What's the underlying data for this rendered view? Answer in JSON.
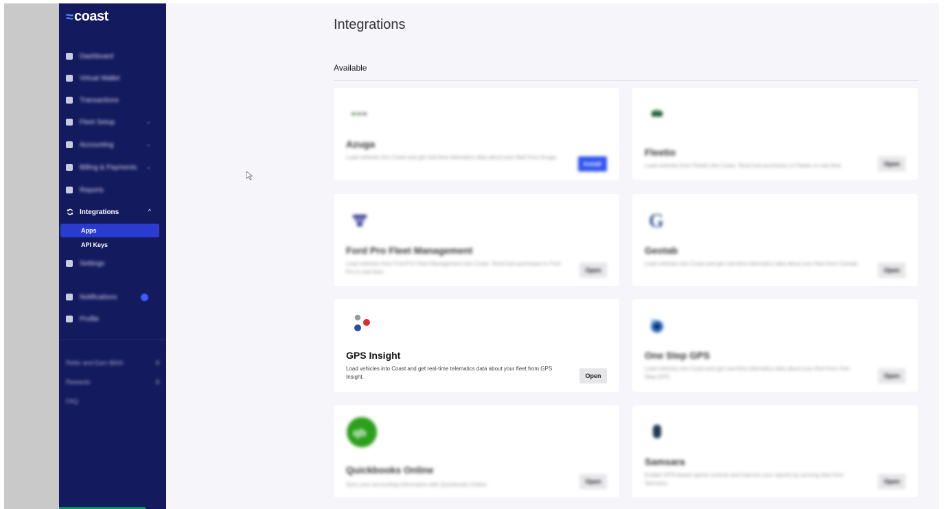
{
  "brand": {
    "logo_text": "coast",
    "logo_mark": "≈"
  },
  "sidebar": {
    "items": [
      {
        "label": "Dashboard",
        "icon": "home-icon"
      },
      {
        "label": "Virtual Wallet",
        "icon": "wallet-icon"
      },
      {
        "label": "Transactions",
        "icon": "list-icon"
      },
      {
        "label": "Fleet Setup",
        "icon": "truck-icon",
        "chevron": "⌄"
      },
      {
        "label": "Accounting",
        "icon": "ledger-icon",
        "chevron": "⌄"
      },
      {
        "label": "Billing & Payments",
        "icon": "card-icon",
        "chevron": "⌄"
      },
      {
        "label": "Reports",
        "icon": "chart-icon"
      },
      {
        "label": "Integrations",
        "icon": "sync-icon",
        "chevron": "^",
        "active": true
      },
      {
        "label": "Settings",
        "icon": "gear-icon"
      },
      {
        "label": "Notifications",
        "icon": "bell-icon"
      },
      {
        "label": "Profile",
        "icon": "user-icon"
      }
    ],
    "sub_items": [
      {
        "label": "Apps",
        "selected": true
      },
      {
        "label": "API Keys",
        "selected": false
      }
    ],
    "bottom_items": [
      {
        "label": "Refer and Earn $500",
        "count": "8"
      },
      {
        "label": "Rewards",
        "count": "8"
      },
      {
        "label": "FAQ",
        "count": ""
      }
    ]
  },
  "main": {
    "title": "Integrations",
    "section_label": "Available",
    "cards": [
      {
        "name": "Azuga",
        "description": "Load vehicles into Coast and get real-time telematics data about your fleet from Azuga.",
        "button": "Install",
        "primary": true,
        "logo": "azuga-logo",
        "blurred": true
      },
      {
        "name": "Fleetio",
        "description": "Load vehicles from Fleetio into Coast. Send fuel purchases to Fleetio in real time.",
        "button": "Open",
        "primary": false,
        "logo": "fleetio-logo",
        "blurred": true
      },
      {
        "name": "Ford Pro Fleet Management",
        "description": "Load vehicles from Ford Pro Fleet Management into Coast. Send fuel purchases to Ford Pro in real time.",
        "button": "Open",
        "primary": false,
        "logo": "ford-pro-logo",
        "blurred": true
      },
      {
        "name": "Geotab",
        "description": "Load vehicles into Coast and get real-time telematics data about your fleet from Geotab.",
        "button": "Open",
        "primary": false,
        "logo": "geotab-logo",
        "blurred": true
      },
      {
        "name": "GPS Insight",
        "description": "Load vehicles into Coast and get real-time telematics data about your fleet from GPS Insight.",
        "button": "Open",
        "primary": false,
        "logo": "gps-insight-logo",
        "blurred": false
      },
      {
        "name": "One Step GPS",
        "description": "Load vehicles into Coast and get real-time telematics data about your fleet from One Step GPS.",
        "button": "Open",
        "primary": false,
        "logo": "one-step-gps-logo",
        "blurred": true
      },
      {
        "name": "Quickbooks Online",
        "description": "Sync your accounting information with Quickbooks Online.",
        "button": "Open",
        "primary": false,
        "logo": "quickbooks-logo",
        "blurred": true
      },
      {
        "name": "Samsara",
        "description": "Enable GPS-based spend controls and improve your reports by syncing data from Samsara.",
        "button": "Open",
        "primary": false,
        "logo": "samsara-logo",
        "blurred": true
      }
    ]
  },
  "colors": {
    "sidebar_bg": "#141a5e",
    "accent": "#2f55f0",
    "selected_sub": "#2a3bd0",
    "main_bg": "#f5f5fa",
    "quickbooks_green": "#2ca01c",
    "gps_insight_red": "#e4282d",
    "gps_insight_blue": "#2a4f9c"
  }
}
